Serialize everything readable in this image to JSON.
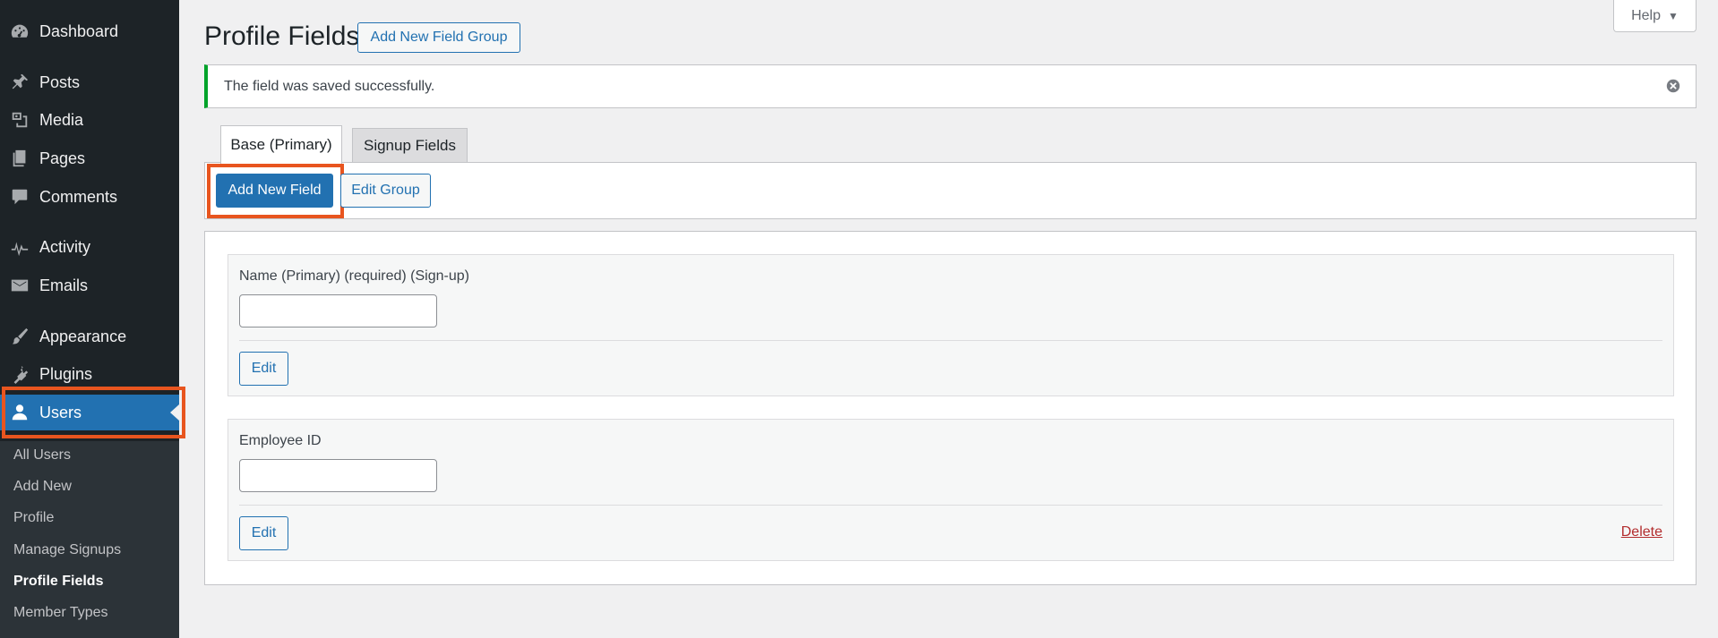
{
  "sidebar": {
    "items": [
      {
        "label": "Dashboard",
        "icon": "dashboard-icon"
      },
      {
        "label": "Posts",
        "icon": "pushpin-icon"
      },
      {
        "label": "Media",
        "icon": "media-icon"
      },
      {
        "label": "Pages",
        "icon": "pages-icon"
      },
      {
        "label": "Comments",
        "icon": "comment-icon"
      },
      {
        "label": "Activity",
        "icon": "activity-icon"
      },
      {
        "label": "Emails",
        "icon": "email-icon"
      },
      {
        "label": "Appearance",
        "icon": "brush-icon"
      },
      {
        "label": "Plugins",
        "icon": "plugin-icon"
      },
      {
        "label": "Users",
        "icon": "user-icon"
      }
    ],
    "submenu": [
      {
        "label": "All Users"
      },
      {
        "label": "Add New"
      },
      {
        "label": "Profile"
      },
      {
        "label": "Manage Signups"
      },
      {
        "label": "Profile Fields"
      },
      {
        "label": "Member Types"
      }
    ]
  },
  "header": {
    "title": "Profile Fields",
    "add_group_label": "Add New Field Group",
    "help_label": "Help"
  },
  "notice": {
    "message": "The field was saved successfully."
  },
  "tabs": [
    {
      "label": "Base (Primary)"
    },
    {
      "label": "Signup Fields"
    }
  ],
  "toolbar": {
    "add_field_label": "Add New Field",
    "edit_group_label": "Edit Group"
  },
  "fields": [
    {
      "label": "Name (Primary) (required) (Sign-up)",
      "value": "",
      "edit_label": "Edit"
    },
    {
      "label": "Employee ID",
      "value": "",
      "edit_label": "Edit",
      "delete_label": "Delete"
    }
  ],
  "colors": {
    "sidebar_bg": "#1d2327",
    "accent": "#2271b1",
    "success": "#00a32a",
    "highlight": "#e8551f",
    "danger": "#b32d2e"
  }
}
